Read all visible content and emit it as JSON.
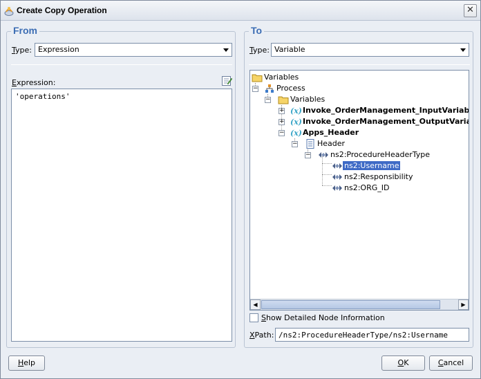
{
  "window": {
    "title": "Create Copy Operation",
    "close_glyph": "✕"
  },
  "from": {
    "legend": "From",
    "type_label_u": "T",
    "type_label_rest": "ype:",
    "type_value": "Expression",
    "expression_label_u": "E",
    "expression_label_rest": "xpression:",
    "expression_value": "'operations'"
  },
  "to": {
    "legend": "To",
    "type_label_u": "T",
    "type_label_pre": "",
    "type_label_rest": "ype:",
    "type_value": "Variable",
    "tree": [
      {
        "label": "Variables",
        "icon": "folder-icon"
      },
      {
        "label": "Process",
        "icon": "process-icon"
      },
      {
        "label": "Variables",
        "icon": "folder-icon"
      },
      {
        "label": "Invoke_OrderManagement_InputVariable",
        "icon": "variable-icon"
      },
      {
        "label": "Invoke_OrderManagement_OutputVariable",
        "icon": "variable-icon"
      },
      {
        "label": "Apps_Header",
        "icon": "variable-icon"
      },
      {
        "label": "Header",
        "icon": "message-part-icon"
      },
      {
        "label": "ns2:ProcedureHeaderType",
        "icon": "element-icon"
      },
      {
        "label": "ns2:Username",
        "icon": "element-icon"
      },
      {
        "label": "ns2:Responsibility",
        "icon": "element-icon"
      },
      {
        "label": "ns2:ORG_ID",
        "icon": "element-icon"
      }
    ],
    "show_detail_u": "S",
    "show_detail_rest": "how Detailed Node Information",
    "show_detail_checked": false,
    "xpath_label_u": "X",
    "xpath_label_rest": "Path:",
    "xpath_value": "/ns2:ProcedureHeaderType/ns2:Username"
  },
  "buttons": {
    "help_u": "H",
    "help_rest": "elp",
    "ok_u": "O",
    "ok_rest": "K",
    "cancel_u": "C",
    "cancel_rest": "ancel"
  },
  "colors": {
    "legend": "#3c6db4",
    "selection": "#3e6ac6",
    "window_bg": "#eaeef4"
  }
}
